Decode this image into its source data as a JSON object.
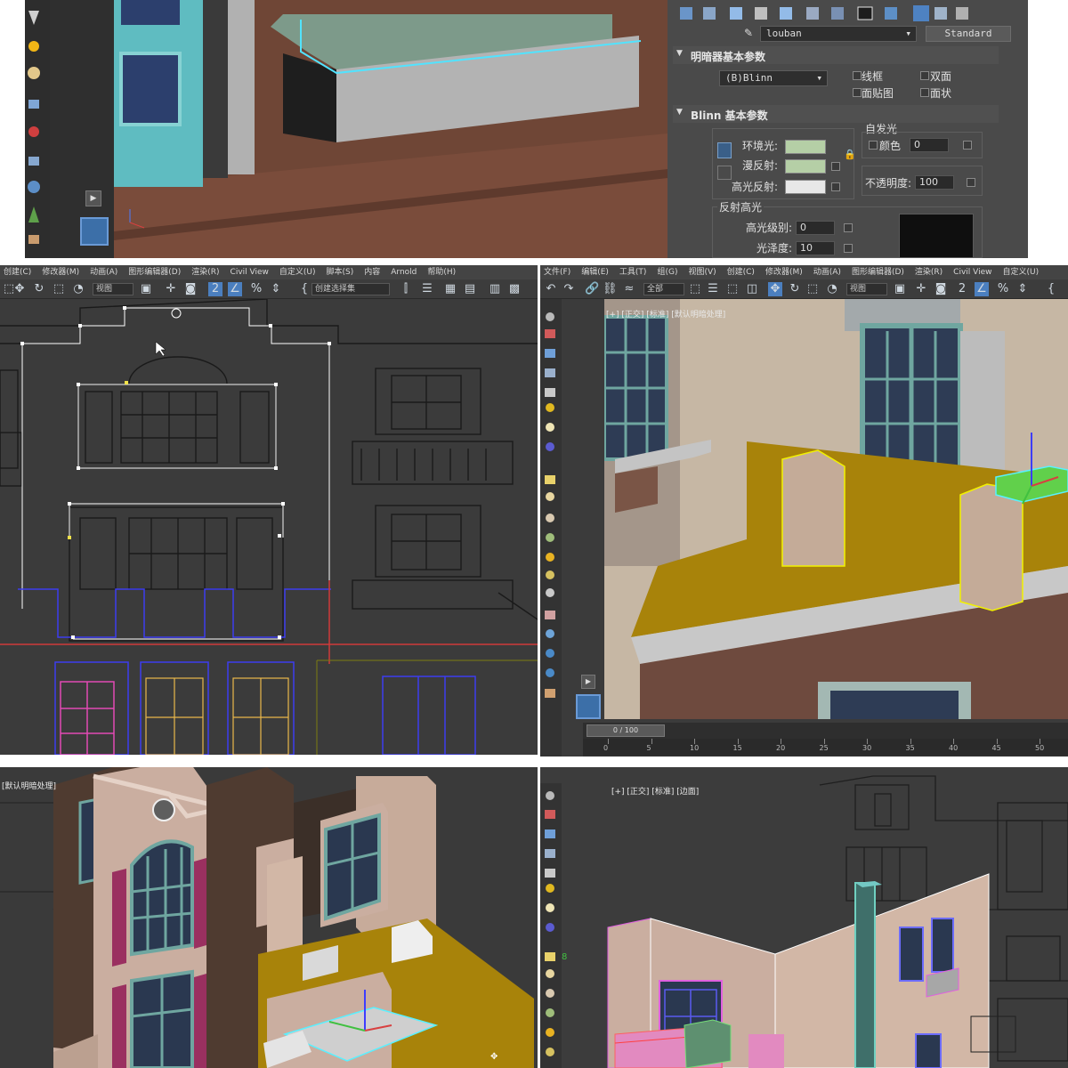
{
  "material_editor": {
    "material_name": "louban",
    "material_type": "Standard",
    "shader_rollout_title": "明暗器基本参数",
    "shader_type": "(B)Blinn",
    "checkbox_wire": "线框",
    "checkbox_two_sided": "双面",
    "checkbox_face_map": "面贴图",
    "checkbox_faceted": "面状",
    "blinn_rollout_title": "Blinn 基本参数",
    "self_illum_title": "自发光",
    "self_illum_color_label": "颜色",
    "self_illum_value": "0",
    "ambient_label": "环境光:",
    "diffuse_label": "漫反射:",
    "specular_label": "高光反射:",
    "opacity_label": "不透明度:",
    "opacity_value": "100",
    "spec_highlights_title": "反射高光",
    "spec_level_label": "高光级别:",
    "spec_level_value": "0",
    "glossiness_label": "光泽度:",
    "glossiness_value": "10",
    "colors": {
      "ambient": "#b5cfa6",
      "diffuse": "#b5cfa6",
      "specular": "#e8e8e8"
    }
  },
  "menus_p2": [
    "创建(C)",
    "修改器(M)",
    "动画(A)",
    "图形编辑器(D)",
    "渲染(R)",
    "Civil View",
    "自定义(U)",
    "脚本(S)",
    "内容",
    "Arnold",
    "帮助(H)"
  ],
  "menus_p3": [
    "文件(F)",
    "编辑(E)",
    "工具(T)",
    "组(G)",
    "视图(V)",
    "创建(C)",
    "修改器(M)",
    "动画(A)",
    "图形编辑器(D)",
    "渲染(R)",
    "Civil View",
    "自定义(U)"
  ],
  "toolbar_p2": {
    "view_dropdown": "视图",
    "selection_set": "创建选择集"
  },
  "toolbar_p3": {
    "filter_dropdown": "全部",
    "view_dropdown": "视图"
  },
  "viewport_p3_label": "[+] [正交] [标准] [默认明暗处理]",
  "viewport_p4_label": "[默认明暗处理]",
  "viewport_p5_label": "[+] [正交] [标准] [边面]",
  "timeline": {
    "frame_display": "0 / 100",
    "ticks": [
      "0",
      "5",
      "10",
      "15",
      "20",
      "25",
      "30",
      "35",
      "40",
      "45",
      "50"
    ]
  }
}
